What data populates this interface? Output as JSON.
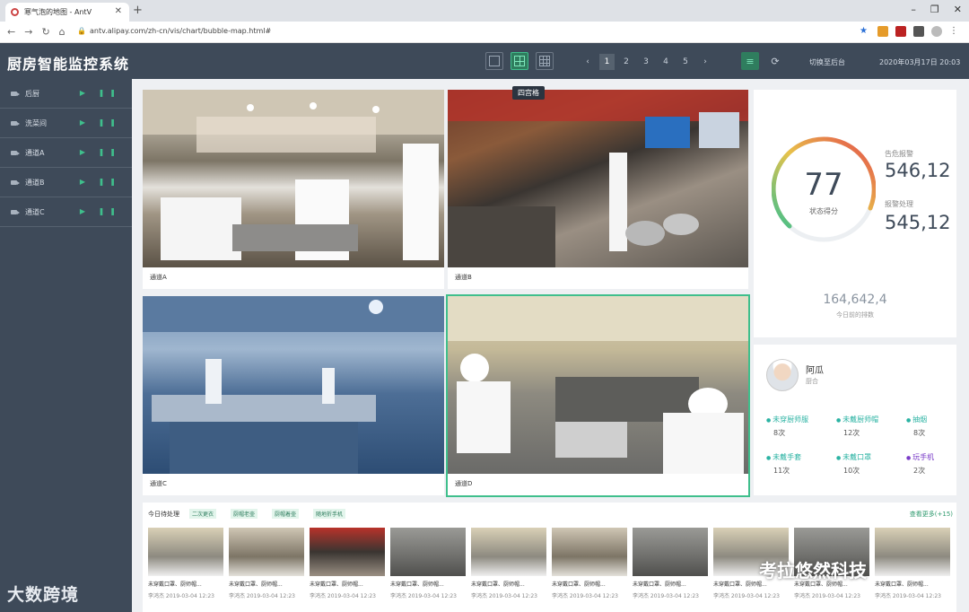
{
  "browser": {
    "tab_title": "寒气泡的地图 - AntV",
    "url": "antv.alipay.com/zh-cn/vis/chart/bubble-map.html#"
  },
  "app": {
    "title": "厨房智能监控系统",
    "layout_tooltip": "四宫格",
    "pages": [
      "1",
      "2",
      "3",
      "4",
      "5"
    ],
    "current_page": "1",
    "backend_label": "切换至后台",
    "datetime": "2020年03月17日 20:03"
  },
  "sidebar": {
    "items": [
      {
        "label": "后厨"
      },
      {
        "label": "洗菜间"
      },
      {
        "label": "通道A"
      },
      {
        "label": "通道B"
      },
      {
        "label": "通道C"
      }
    ]
  },
  "cameras": [
    {
      "label": "通道A"
    },
    {
      "label": "通道B"
    },
    {
      "label": "通道C"
    },
    {
      "label": "通道D"
    }
  ],
  "stats": {
    "score": "77",
    "score_label": "状态得分",
    "alarm_label": "告危报警",
    "alarm_value": "546,12",
    "handled_label": "报警处理",
    "handled_value": "545,12",
    "total_value": "164,642,4",
    "total_label": "今日前的排数"
  },
  "person": {
    "name": "阿瓜",
    "role": "厨合",
    "violations": [
      {
        "name": "未穿厨师服",
        "count": "8次",
        "color": "#2bb3a3"
      },
      {
        "name": "未戴厨师帽",
        "count": "12次",
        "color": "#2bb3a3"
      },
      {
        "name": "抽烟",
        "count": "8次",
        "color": "#2bb3a3"
      },
      {
        "name": "未戴手套",
        "count": "11次",
        "color": "#2bb3a3"
      },
      {
        "name": "未戴口罩",
        "count": "10次",
        "color": "#2bb3a3"
      },
      {
        "name": "玩手机",
        "count": "2次",
        "color": "#7a3cc8"
      }
    ]
  },
  "records": {
    "title": "今日待处理",
    "tags": [
      "二次更衣",
      "厨帽老壶",
      "厨帽着壶",
      "随地折手机"
    ],
    "more": "查看更多(+15)",
    "items": [
      {
        "title": "未穿戴口罩、厨师帽...",
        "time": "李鸿杰   2019-03-04 12:23"
      },
      {
        "title": "未穿戴口罩、厨师帽...",
        "time": "李鸿杰   2019-03-04 12:23"
      },
      {
        "title": "未穿戴口罩、厨师帽...",
        "time": "李鸿杰   2019-03-04 12:23"
      },
      {
        "title": "未穿戴口罩、厨师帽...",
        "time": "李鸿杰   2019-03-04 12:23"
      },
      {
        "title": "未穿戴口罩、厨师帽...",
        "time": "李鸿杰   2019-03-04 12:23"
      },
      {
        "title": "未穿戴口罩、厨师帽...",
        "time": "李鸿杰   2019-03-04 12:23"
      },
      {
        "title": "未穿戴口罩、厨师帽...",
        "time": "李鸿杰   2019-03-04 12:23"
      },
      {
        "title": "未穿戴口罩、厨师帽...",
        "time": "李鸿杰   2019-03-04 12:23"
      },
      {
        "title": "未穿戴口罩、厨师帽...",
        "time": "李鸿杰   2019-03-04 12:23"
      },
      {
        "title": "未穿戴口罩、厨师帽...",
        "time": "李鸿杰   2019-03-04 12:23"
      }
    ]
  },
  "watermarks": {
    "left": "大数跨境",
    "right": "考拉悠然科技"
  },
  "colors": {
    "header_bg": "#3e4a59",
    "accent": "#3fbf8c"
  }
}
